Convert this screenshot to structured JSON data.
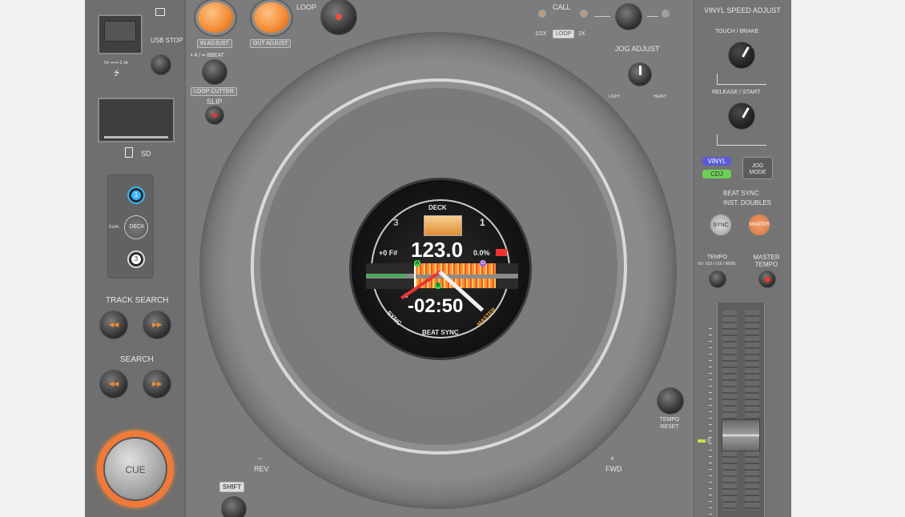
{
  "top": {
    "loop_label": "LOOP",
    "in_adjust": "IN ADJUST",
    "out_adjust": "OUT ADJUST",
    "beat_divider": "• 4 / ━ 8BEAT",
    "loop_cutter": "LOOP CUTTER",
    "slip": "SLIP",
    "call": "CALL",
    "half_x": "1/2X",
    "loop_tag": "LOOP",
    "two_x": "2X"
  },
  "left": {
    "usb_rating": "5V ═══ 2.1A",
    "usb_symbol": "⭍",
    "usb_stop": "USB STOP",
    "sd": "SD",
    "dual": "DUAL",
    "deck1": "1",
    "deck_btn": "DECK",
    "deck3": "3",
    "track_search": "TRACK SEARCH",
    "search": "SEARCH",
    "cue": "CUE",
    "shift": "SHIFT"
  },
  "jog": {
    "rev": "REV",
    "rev_sign": "−",
    "fwd": "FWD",
    "fwd_sign": "+",
    "jog_adjust": "JOG ADJUST",
    "light": "LIGHT",
    "heavy": "HEAVY",
    "tempo_reset": "TEMPO RESET"
  },
  "display": {
    "deck_label": "DECK",
    "deck_left": "3",
    "deck_right": "1",
    "bpm": "123.0",
    "key": "+0 F#",
    "pitch": "0.0%",
    "time": "-02:50",
    "sync": "SYNC",
    "beat_sync": "BEAT SYNC",
    "master": "MASTER",
    "zero_marker": "0",
    "four_marker": "4",
    "hot_cue_a": "A",
    "hot_cue_b": "B",
    "hot_cue_d": "D"
  },
  "right": {
    "vinyl_speed": "VINYL SPEED ADJUST",
    "touch_brake": "TOUCH / BRAKE",
    "release_start": "RELEASE / START",
    "vinyl": "VINYL",
    "cdj": "CDJ",
    "jog_mode": "JOG MODE",
    "beat_sync": "BEAT SYNC",
    "inst_doubles": "INST. DOUBLES",
    "sync": "SYNC",
    "master": "MASTER",
    "tempo": "TEMPO",
    "tempo_ranges": "±6 / ±10 / ±16 / WIDE",
    "master_tempo": "MASTER TEMPO",
    "tempo_zero": "0"
  },
  "colors": {
    "accent_orange": "#f38a32",
    "deck_blue": "#37b8ff",
    "vinyl_purple": "#5b5bd8",
    "cdj_green": "#6ccf54"
  }
}
